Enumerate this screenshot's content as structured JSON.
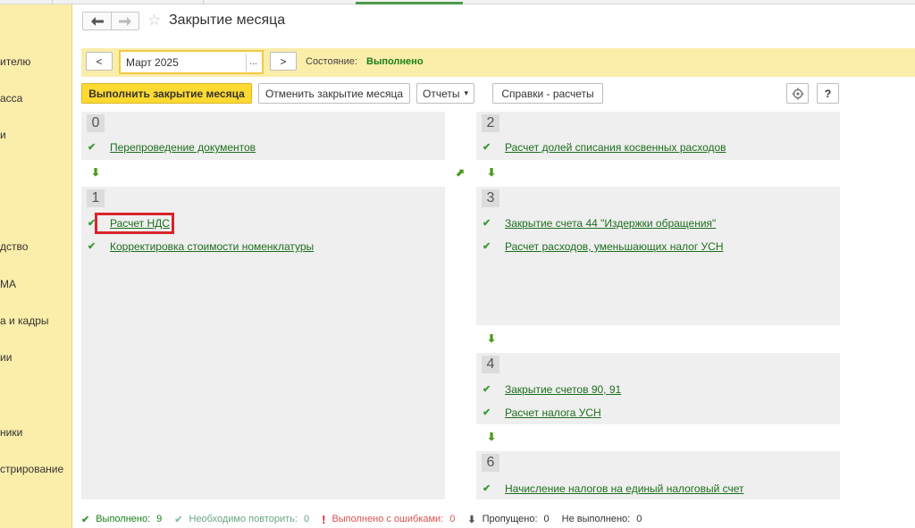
{
  "sidebar": {
    "items": [
      "ителю",
      "асса",
      "и",
      "дство",
      "МА",
      "а и кадры",
      "ии",
      "ники",
      "стрирование"
    ]
  },
  "header": {
    "title": "Закрытие месяца",
    "back_icon": "arrow-left-icon",
    "forward_icon": "arrow-right-icon",
    "favorite_icon": "star-icon"
  },
  "period": {
    "prev_label": "<",
    "next_label": ">",
    "date_value": "Март 2025",
    "picker_label": "...",
    "state_label": "Состояние:",
    "state_value": "Выполнено"
  },
  "toolbar": {
    "run_label": "Выполнить закрытие месяца",
    "cancel_label": "Отменить закрытие месяца",
    "reports_label": "Отчеты",
    "reports_arrow": "▾",
    "calc_label": "Справки - расчеты",
    "settings_icon": "gear-icon",
    "help_label": "?"
  },
  "groups": {
    "g0": {
      "num": "0",
      "tasks": [
        {
          "label": "Перепроведение документов"
        }
      ]
    },
    "g1": {
      "num": "1",
      "tasks": [
        {
          "label": "Расчет НДС"
        },
        {
          "label": "Корректировка стоимости номенклатуры"
        }
      ]
    },
    "g2": {
      "num": "2",
      "tasks": [
        {
          "label": "Расчет долей списания косвенных расходов"
        }
      ]
    },
    "g3": {
      "num": "3",
      "tasks": [
        {
          "label": "Закрытие счета 44 \"Издержки обращения\""
        },
        {
          "label": "Расчет расходов, уменьшающих налог УСН"
        }
      ]
    },
    "g4": {
      "num": "4",
      "tasks": [
        {
          "label": "Закрытие счетов 90, 91"
        },
        {
          "label": "Расчет налога УСН"
        }
      ]
    },
    "g6": {
      "num": "6",
      "tasks": [
        {
          "label": "Начисление налогов на единый налоговый счет"
        }
      ]
    }
  },
  "check_glyph": "✔",
  "arrow_down_glyph": "⬇",
  "arrow_diag_glyph": "⬈",
  "footer": {
    "done_label": "Выполнено:",
    "done_count": "9",
    "done_color": "#1a7f1a",
    "repeat_label": "Необходимо повторить:",
    "repeat_count": "0",
    "repeat_color": "#6aa585",
    "errors_label": "Выполнено с ошибками:",
    "errors_count": "0",
    "errors_color": "#d9534f",
    "skipped_label": "Пропущено:",
    "skipped_count": "0",
    "notdone_label": "Не выполнено:",
    "notdone_count": "0"
  }
}
